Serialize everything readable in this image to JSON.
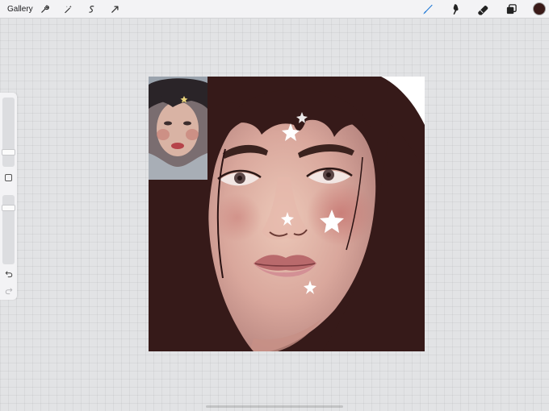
{
  "toolbar": {
    "gallery_label": "Gallery",
    "left_tools": [
      {
        "name": "actions-icon"
      },
      {
        "name": "adjustments-icon"
      },
      {
        "name": "selection-icon"
      },
      {
        "name": "transform-icon"
      }
    ],
    "right_tools": [
      {
        "name": "brush-icon",
        "active": true,
        "color": "#1e78d6"
      },
      {
        "name": "smudge-icon"
      },
      {
        "name": "eraser-icon"
      },
      {
        "name": "layers-icon"
      }
    ],
    "current_color": "#3a1a18"
  },
  "sidebar": {
    "size_slider": {
      "name": "brush-size-slider",
      "level": 0.18
    },
    "modify_button": {
      "name": "modify-button-icon"
    },
    "opacity_slider": {
      "name": "opacity-slider",
      "level": 0.85
    },
    "undo": {
      "name": "undo-icon"
    },
    "redo": {
      "name": "redo-icon",
      "enabled": false
    }
  },
  "canvas": {
    "background": "#ffffff",
    "hair_color": "#361a19",
    "skin_color": "#d9a79c",
    "blush_color": "#c4716d",
    "lip_color": "#b96a6c",
    "star_color": "#ffffff"
  },
  "reference_photo": {
    "name": "reference-photo"
  }
}
